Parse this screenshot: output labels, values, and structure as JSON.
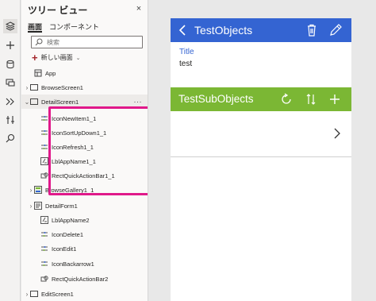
{
  "tree_view": {
    "title": "ツリー ビュー",
    "close_icon": "×",
    "tabs": [
      {
        "label": "画面",
        "active": true
      },
      {
        "label": "コンポーネント",
        "active": false
      }
    ],
    "search": {
      "placeholder": "検索",
      "value": ""
    },
    "new_screen_label": "新しい画面",
    "items": [
      {
        "label": "App",
        "icon": "app-icon",
        "level": 0,
        "chevron": ""
      },
      {
        "label": "BrowseScreen1",
        "icon": "screen-icon",
        "level": 0,
        "chevron": "›"
      },
      {
        "label": "DetailScreen1",
        "icon": "screen-icon",
        "level": 0,
        "chevron": "⌄",
        "selected": true,
        "more": "···"
      },
      {
        "label": "IconNewItem1_1",
        "icon": "icon-control-icon",
        "level": 1,
        "chevron": ""
      },
      {
        "label": "IconSortUpDown1_1",
        "icon": "icon-control-icon",
        "level": 1,
        "chevron": ""
      },
      {
        "label": "IconRefresh1_1",
        "icon": "icon-control-icon",
        "level": 1,
        "chevron": ""
      },
      {
        "label": "LblAppName1_1",
        "icon": "label-icon",
        "level": 1,
        "chevron": ""
      },
      {
        "label": "RectQuickActionBar1_1",
        "icon": "rectangle-icon",
        "level": 1,
        "chevron": ""
      },
      {
        "label": "BrowseGallery1_1",
        "icon": "gallery-icon",
        "level": 1,
        "chevron": "›"
      },
      {
        "label": "DetailForm1",
        "icon": "form-icon",
        "level": 1,
        "chevron": "›"
      },
      {
        "label": "LblAppName2",
        "icon": "label-icon",
        "level": 1,
        "chevron": ""
      },
      {
        "label": "IconDelete1",
        "icon": "icon-control-icon",
        "level": 1,
        "chevron": ""
      },
      {
        "label": "IconEdit1",
        "icon": "icon-control-icon",
        "level": 1,
        "chevron": ""
      },
      {
        "label": "IconBackarrow1",
        "icon": "icon-control-icon",
        "level": 1,
        "chevron": ""
      },
      {
        "label": "RectQuickActionBar2",
        "icon": "rectangle-icon",
        "level": 1,
        "chevron": ""
      },
      {
        "label": "EditScreen1",
        "icon": "screen-icon",
        "level": 0,
        "chevron": "›"
      }
    ]
  },
  "rail": [
    "tree-view-icon",
    "insert-icon",
    "data-icon",
    "media-icon",
    "advanced-tools-icon",
    "variables-icon",
    "search-icon"
  ],
  "canvas": {
    "top_header": {
      "title": "TestObjects",
      "color": "#3464d2"
    },
    "field": {
      "label": "Title",
      "value": "test"
    },
    "sub_header": {
      "title": "TestSubObjects",
      "color": "#7bb734"
    }
  },
  "highlight_color": "#e0198a"
}
